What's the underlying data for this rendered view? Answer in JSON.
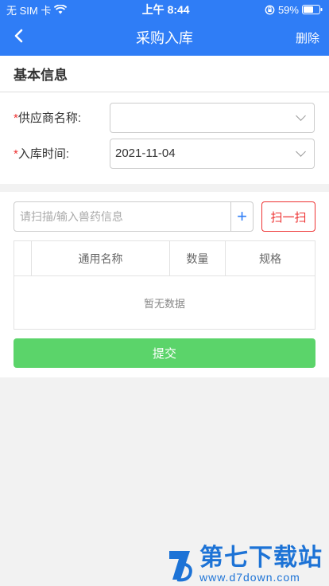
{
  "status_bar": {
    "carrier": "无 SIM 卡",
    "time": "上午 8:44",
    "battery": "59%"
  },
  "nav": {
    "title": "采购入库",
    "delete_label": "删除"
  },
  "basic": {
    "heading": "基本信息",
    "supplier": {
      "required_mark": "*",
      "label": "供应商名称:",
      "value": ""
    },
    "date": {
      "required_mark": "*",
      "label": "入库时间:",
      "value": "2021-11-04"
    }
  },
  "scan": {
    "placeholder": "请扫描/输入兽药信息",
    "plus": "+",
    "scan_label": "扫一扫"
  },
  "table": {
    "columns": [
      "",
      "通用名称",
      "数量",
      "规格"
    ],
    "empty_text": "暂无数据"
  },
  "submit_label": "提交",
  "watermark": {
    "brand": "第七下载站",
    "url": "www.d7down.com"
  },
  "colors": {
    "primary": "#2f7df6",
    "submit": "#5bd46a",
    "danger": "#e33333"
  }
}
